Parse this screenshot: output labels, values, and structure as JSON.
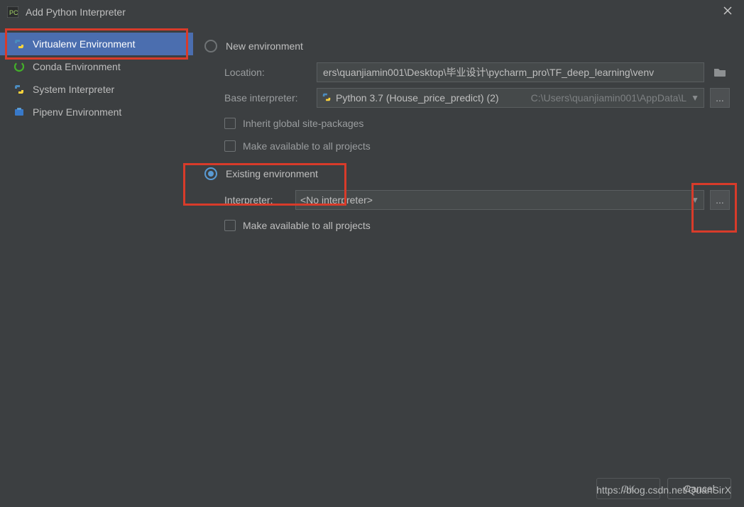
{
  "window": {
    "title": "Add Python Interpreter"
  },
  "sidebar": {
    "items": [
      {
        "label": "Virtualenv Environment"
      },
      {
        "label": "Conda Environment"
      },
      {
        "label": "System Interpreter"
      },
      {
        "label": "Pipenv Environment"
      }
    ]
  },
  "main": {
    "new_env": {
      "radio_label": "New environment",
      "location_label": "Location:",
      "location_value": "ers\\quanjiamin001\\Desktop\\毕业设计\\pycharm_pro\\TF_deep_learning\\venv",
      "base_label": "Base interpreter:",
      "base_value": "Python 3.7 (House_price_predict) (2)",
      "base_path": "C:\\Users\\quanjiamin001\\AppData\\L",
      "inherit_label": "Inherit global site-packages",
      "make_avail_label": "Make available to all projects"
    },
    "existing_env": {
      "radio_label": "Existing environment",
      "interpreter_label": "Interpreter:",
      "interpreter_value": "<No interpreter>",
      "make_avail_label": "Make available to all projects"
    }
  },
  "footer": {
    "ok_label": "OK",
    "cancel_label": "Cancel"
  },
  "watermark": "https://blog.csdn.net/QuanSirX",
  "ellipsis": "..."
}
